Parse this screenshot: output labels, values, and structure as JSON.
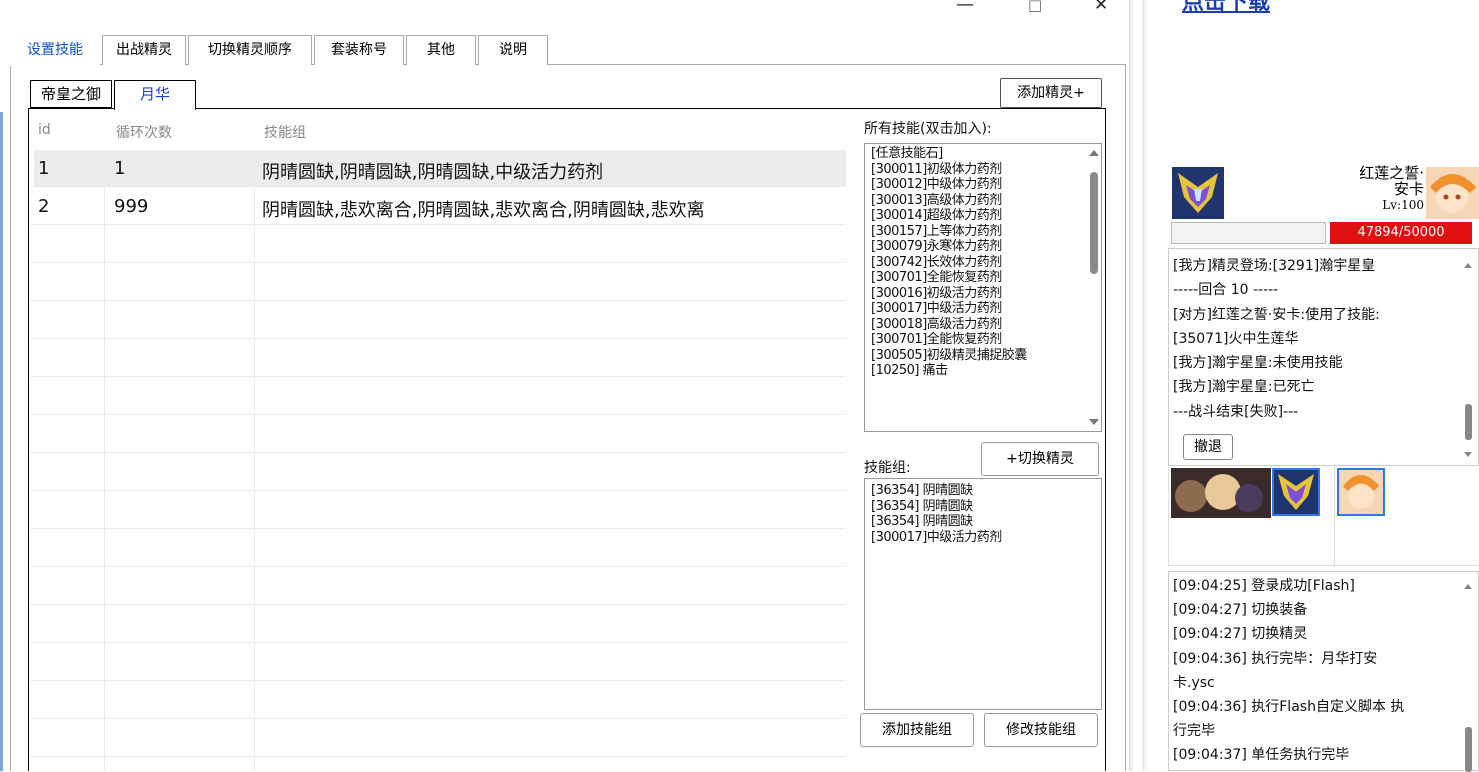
{
  "window": {
    "minimize": "—",
    "maximize": "□",
    "close": "✕"
  },
  "tabs": [
    "设置技能",
    "出战精灵",
    "切换精灵顺序",
    "套装称号",
    "其他",
    "说明"
  ],
  "sub_tabs": [
    "帝皇之御",
    "月华"
  ],
  "add_sprite_button": "添加精灵+",
  "table": {
    "columns": [
      "id",
      "循环次数",
      "技能组"
    ],
    "rows": [
      {
        "id": "1",
        "loops": "1",
        "skills": "阴晴圆缺,阴晴圆缺,阴晴圆缺,中级活力药剂"
      },
      {
        "id": "2",
        "loops": "999",
        "skills": "阴晴圆缺,悲欢离合,阴晴圆缺,悲欢离合,阴晴圆缺,悲欢离"
      }
    ]
  },
  "all_skills": {
    "label": "所有技能(双击加入):",
    "items": [
      "[任意技能石]",
      "[300011]初级体力药剂",
      "[300012]中级体力药剂",
      "[300013]高级体力药剂",
      "[300014]超级体力药剂",
      "[300157]上等体力药剂",
      "[300079]永寒体力药剂",
      "[300742]长效体力药剂",
      "[300701]全能恢复药剂",
      "[300016]初级活力药剂",
      "[300017]中级活力药剂",
      "[300018]高级活力药剂",
      "[300701]全能恢复药剂",
      "[300505]初级精灵捕捉胶囊",
      "[10250] 痛击"
    ]
  },
  "switch_sprite_button": "+切换精灵",
  "skill_group": {
    "label": "技能组:",
    "items": [
      "[36354] 阴晴圆缺",
      "[36354] 阴晴圆缺",
      "[36354] 阴晴圆缺",
      "[300017]中级活力药剂"
    ]
  },
  "add_group_button": "添加技能组",
  "edit_group_button": "修改技能组",
  "game": {
    "top_link": "点击下载",
    "enemy_name_line1": "红莲之誓·",
    "enemy_name_line2": "安卡",
    "enemy_level": "Lv:100",
    "enemy_hp": "47894/50000",
    "hp_color": "#e01010",
    "battle_log": [
      "[我方]精灵登场:[3291]瀚宇星皇",
      "-----回合 10 -----",
      "[对方]红莲之誓·安卡:使用了技能:",
      "[35071]火中生莲华",
      "[我方]瀚宇星皇:未使用技能",
      "[我方]瀚宇星皇:已死亡",
      "---战斗结束[失败]---"
    ],
    "retreat_button": "撤退",
    "sys_log": [
      "[09:04:25] 登录成功[Flash]",
      "[09:04:27] 切换装备",
      "[09:04:27] 切换精灵",
      "[09:04:36] 执行完毕：月华打安",
      "卡.ysc",
      "[09:04:36] 执行Flash自定义脚本 执",
      "行完毕",
      "[09:04:37] 单任务执行完毕"
    ]
  }
}
